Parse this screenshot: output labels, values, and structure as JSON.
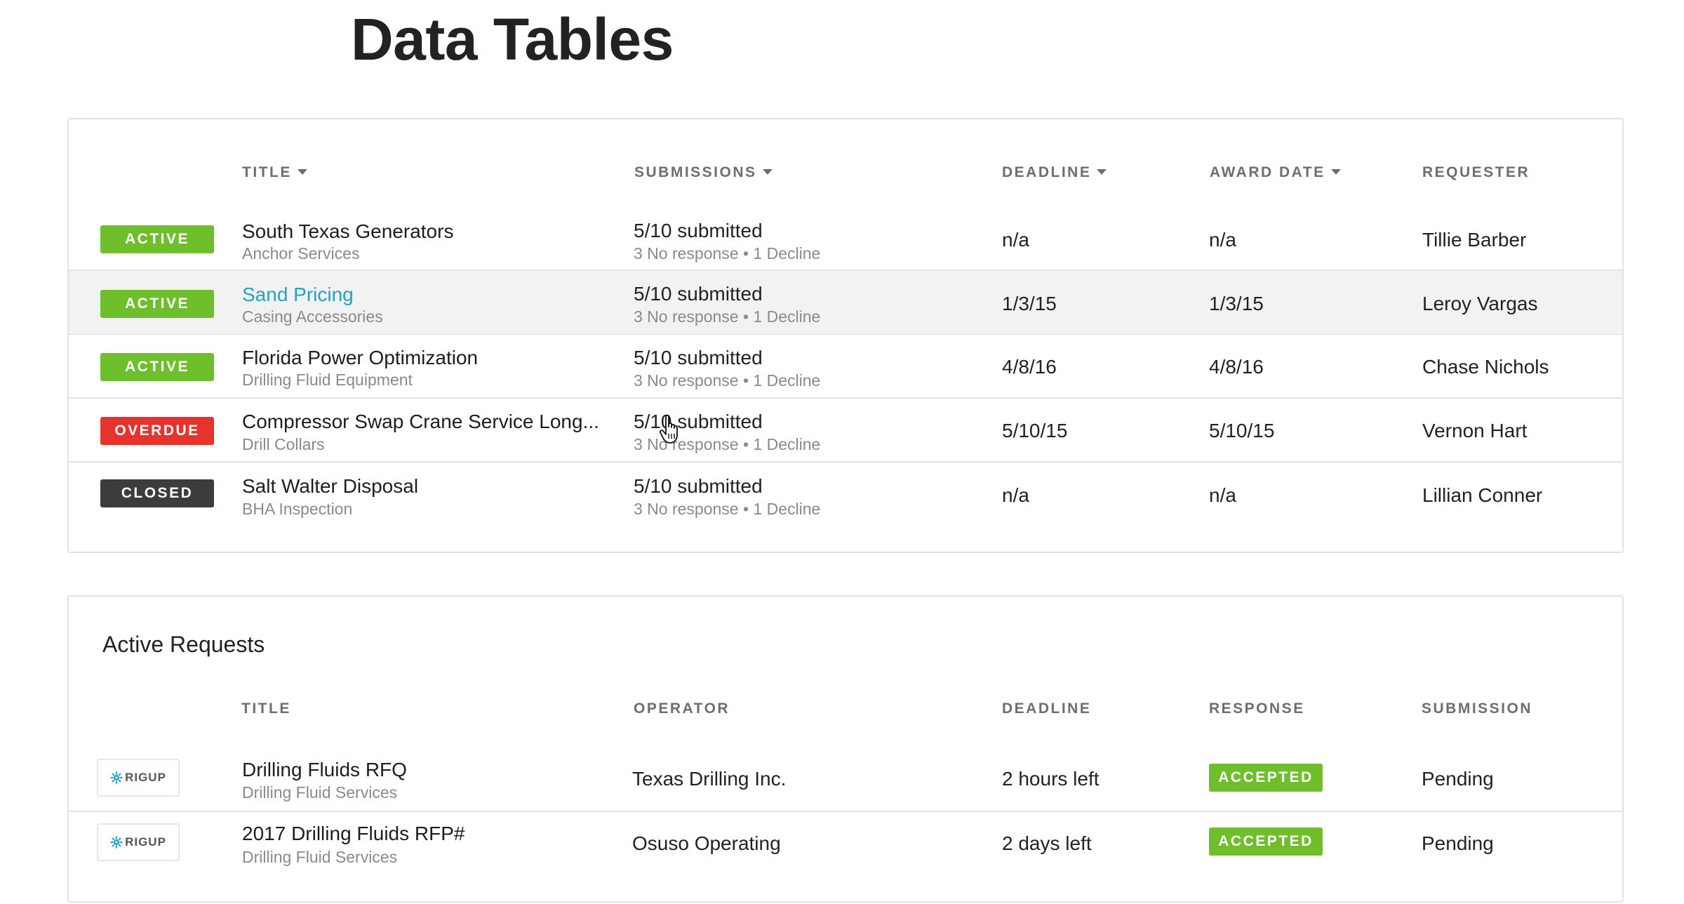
{
  "page": {
    "title": "Data Tables"
  },
  "rfx_table": {
    "columns": {
      "title": "TITLE",
      "submissions": "SUBMISSIONS",
      "deadline": "DEADLINE",
      "award_date": "AWARD DATE",
      "requester": "REQUESTER"
    },
    "rows": [
      {
        "status": "ACTIVE",
        "status_color": "#6fbf2c",
        "title": "South Texas Generators",
        "subtitle": "Anchor Services",
        "submitted": "5/10 submitted",
        "responses": "3 No response • 1 Decline",
        "deadline": "n/a",
        "award_date": "n/a",
        "requester": "Tillie Barber"
      },
      {
        "status": "ACTIVE",
        "status_color": "#6fbf2c",
        "title": "Sand Pricing",
        "subtitle": "Casing Accessories",
        "submitted": "5/10 submitted",
        "responses": "3 No response • 1 Decline",
        "deadline": "1/3/15",
        "award_date": "1/3/15",
        "requester": "Leroy Vargas"
      },
      {
        "status": "ACTIVE",
        "status_color": "#6fbf2c",
        "title": "Florida Power Optimization",
        "subtitle": "Drilling Fluid Equipment",
        "submitted": "5/10 submitted",
        "responses": "3 No response • 1 Decline",
        "deadline": "4/8/16",
        "award_date": "4/8/16",
        "requester": "Chase Nichols"
      },
      {
        "status": "OVERDUE",
        "status_color": "#e8322c",
        "title": "Compressor Swap Crane Service Long...",
        "subtitle": "Drill Collars",
        "submitted": "5/10 submitted",
        "responses": "3 No response • 1 Decline",
        "deadline": "5/10/15",
        "award_date": "5/10/15",
        "requester": "Vernon Hart"
      },
      {
        "status": "CLOSED",
        "status_color": "#3c3c3c",
        "title": "Salt Walter Disposal",
        "subtitle": "BHA Inspection",
        "submitted": "5/10 submitted",
        "responses": "3 No response • 1 Decline",
        "deadline": "n/a",
        "award_date": "n/a",
        "requester": "Lillian Conner"
      }
    ]
  },
  "active_requests": {
    "heading": "Active Requests",
    "columns": {
      "title": "TITLE",
      "operator": "OPERATOR",
      "deadline": "DEADLINE",
      "response": "RESPONSE",
      "submission": "SUBMISSION"
    },
    "rows": [
      {
        "logo": "RIGUP",
        "logo_icon": "gear-icon",
        "title": "Drilling Fluids RFQ",
        "subtitle": "Drilling Fluid Services",
        "operator": "Texas Drilling Inc.",
        "deadline": "2 hours left",
        "response": "ACCEPTED",
        "submission": "Pending"
      },
      {
        "logo": "RIGUP",
        "logo_icon": "gear-icon",
        "title": "2017 Drilling Fluids RFP#",
        "subtitle": "Drilling Fluid Services",
        "operator": "Osuso Operating",
        "deadline": "2 days left",
        "response": "ACCEPTED",
        "submission": "Pending"
      }
    ]
  },
  "colors": {
    "accent_link": "#21a3c4",
    "active": "#6fbf2c",
    "overdue": "#e8322c",
    "closed": "#3c3c3c",
    "logo_blue": "#21a3c4"
  }
}
